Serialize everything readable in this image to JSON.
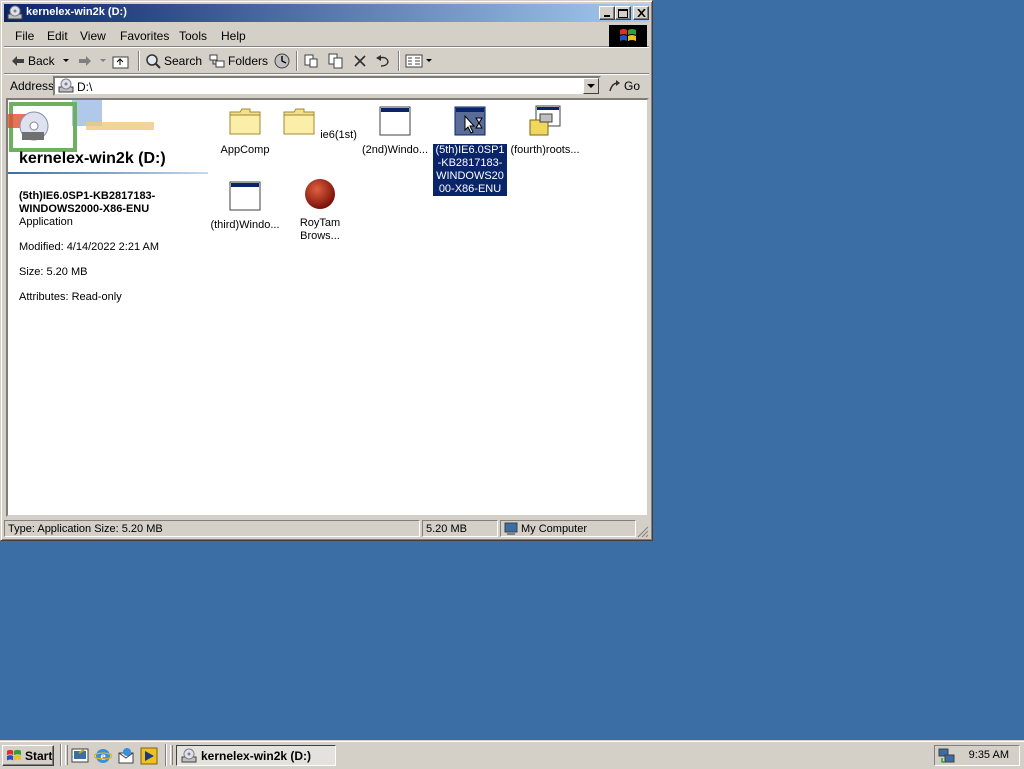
{
  "window": {
    "title": "kernelex-win2k (D:)",
    "menu": [
      "File",
      "Edit",
      "View",
      "Favorites",
      "Tools",
      "Help"
    ],
    "toolbar": {
      "back": "Back",
      "search": "Search",
      "folders": "Folders"
    },
    "address": {
      "label": "Address",
      "value": "D:\\",
      "go": "Go"
    },
    "left_pane": {
      "title": "kernelex-win2k (D:)",
      "file_name": "(5th)IE6.0SP1-KB2817183-WINDOWS2000-X86-ENU",
      "file_type": "Application",
      "modified": "Modified: 4/14/2022 2:21 AM",
      "size": "Size: 5.20 MB",
      "attributes": "Attributes: Read-only"
    },
    "items": [
      {
        "label": "AppComp",
        "icon": "folder-icon"
      },
      {
        "label": "ie6(1st)",
        "icon": "folder-icon"
      },
      {
        "label": "(2nd)Windo...",
        "icon": "application-window-icon"
      },
      {
        "label": "(5th)IE6.0SP1-KB2817183-WINDOWS2000-X86-ENU",
        "icon": "application-window-icon",
        "selected": true
      },
      {
        "label": "(fourth)roots...",
        "icon": "installer-package-icon"
      },
      {
        "label": "(third)Windo...",
        "icon": "application-window-icon"
      },
      {
        "label": "RoyTam Brows...",
        "icon": "red-sphere-icon"
      }
    ],
    "status": {
      "left": "Type: Application Size: 5.20 MB",
      "size": "5.20 MB",
      "zone": "My Computer"
    }
  },
  "taskbar": {
    "start": "Start",
    "task": "kernelex-win2k (D:)",
    "clock": "9:35 AM"
  }
}
